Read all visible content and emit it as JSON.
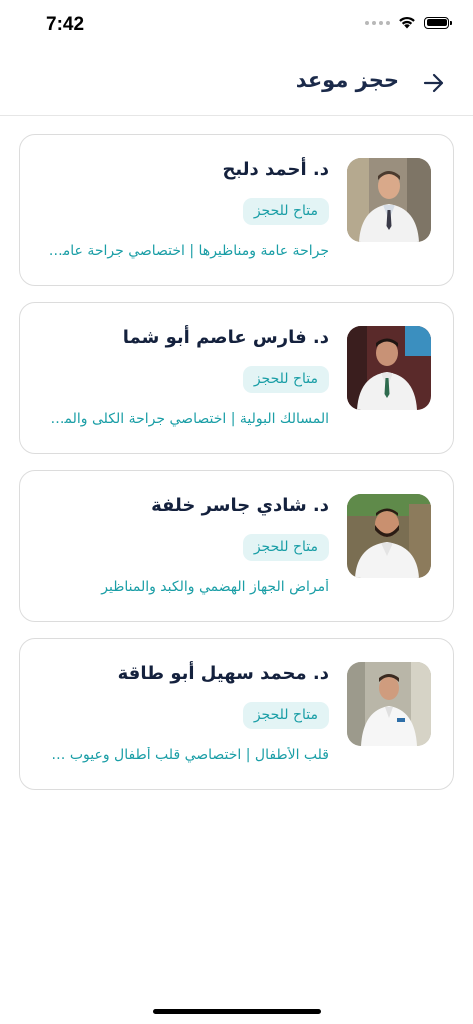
{
  "status_bar": {
    "time": "7:42",
    "icons": [
      "signal-dots-icon",
      "wifi-icon",
      "battery-icon"
    ]
  },
  "header": {
    "title": "حجز موعد",
    "back_icon": "arrow-right-icon"
  },
  "doctors": [
    {
      "name": "د. أحمد دلبح",
      "availability": "متاح للحجز",
      "specialty": "جراحة عامة ومناظيرها | اختصاصي جراحة عامة ومناظير",
      "photo_icon": "doctor-photo"
    },
    {
      "name": "د. فارس عاصم أبو شما",
      "availability": "متاح للحجز",
      "specialty": "المسالك البولية | اختصاصي جراحة الكلى والمسالك البولية",
      "photo_icon": "doctor-photo"
    },
    {
      "name": "د. شادي جاسر خلفة",
      "availability": "متاح للحجز",
      "specialty": "أمراض الجهاز الهضمي والكبد والمناظير",
      "photo_icon": "doctor-photo"
    },
    {
      "name": "د. محمد سهيل أبو طاقة",
      "availability": "متاح للحجز",
      "specialty": "قلب الأطفال | اختصاصي قلب أطفال وعيوب خلقية",
      "photo_icon": "doctor-photo"
    }
  ],
  "colors": {
    "accent": "#1a9ea6",
    "badge_bg": "#e3f4f5",
    "title": "#1b2a4a",
    "border": "#dcdcdc"
  }
}
